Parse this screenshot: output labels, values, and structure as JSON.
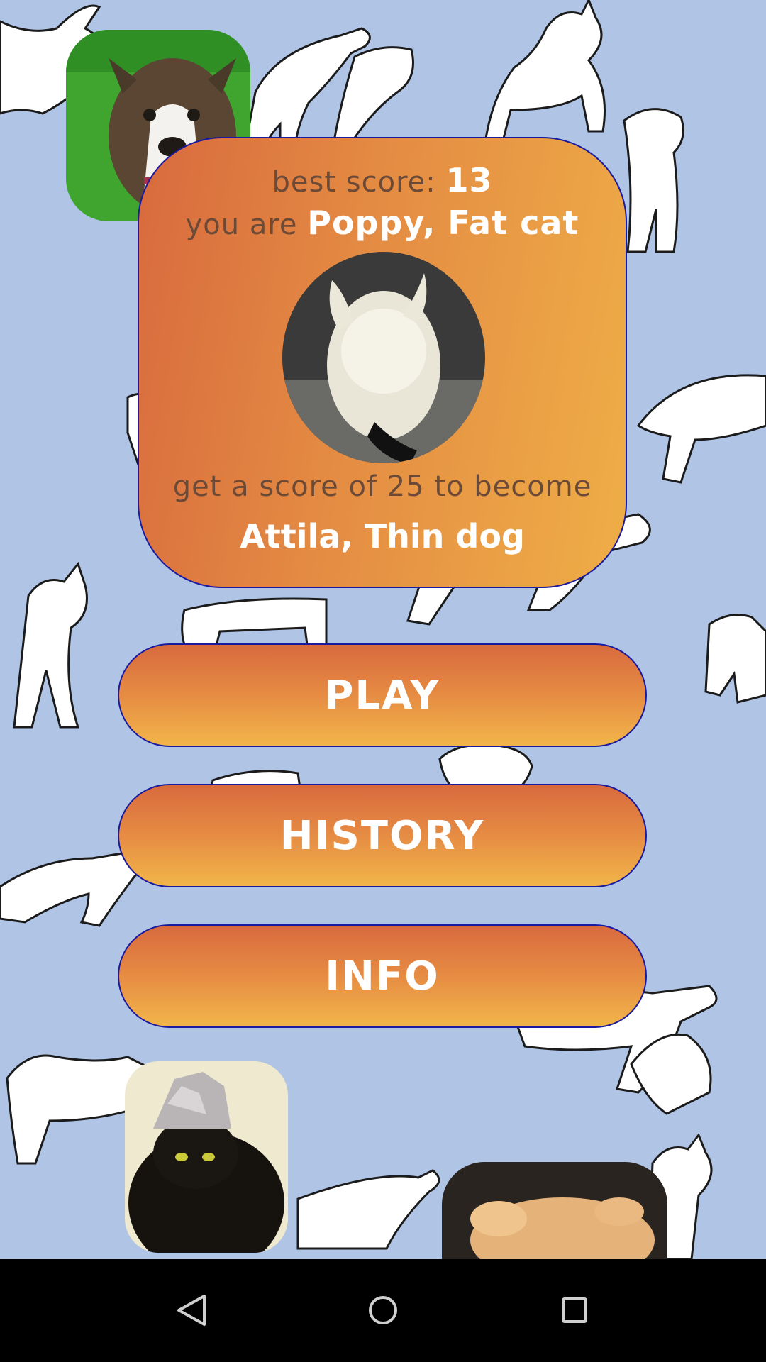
{
  "score_card": {
    "best_score_prefix": "best score: ",
    "best_score_value": "13",
    "you_are_prefix": "you are ",
    "current_rank": "Poppy, Fat cat",
    "next_goal_text": "get a score of 25 to become",
    "next_rank": "Attila, Thin dog"
  },
  "menu": {
    "play_label": "PLAY",
    "history_label": "HISTORY",
    "info_label": "INFO"
  },
  "colors": {
    "background": "#b0c4e6",
    "button_top": "#d86a3e",
    "button_bottom": "#f2b54a",
    "border": "#1a1aa0"
  },
  "navbar_icons": [
    "back-icon",
    "home-icon",
    "recents-icon"
  ]
}
